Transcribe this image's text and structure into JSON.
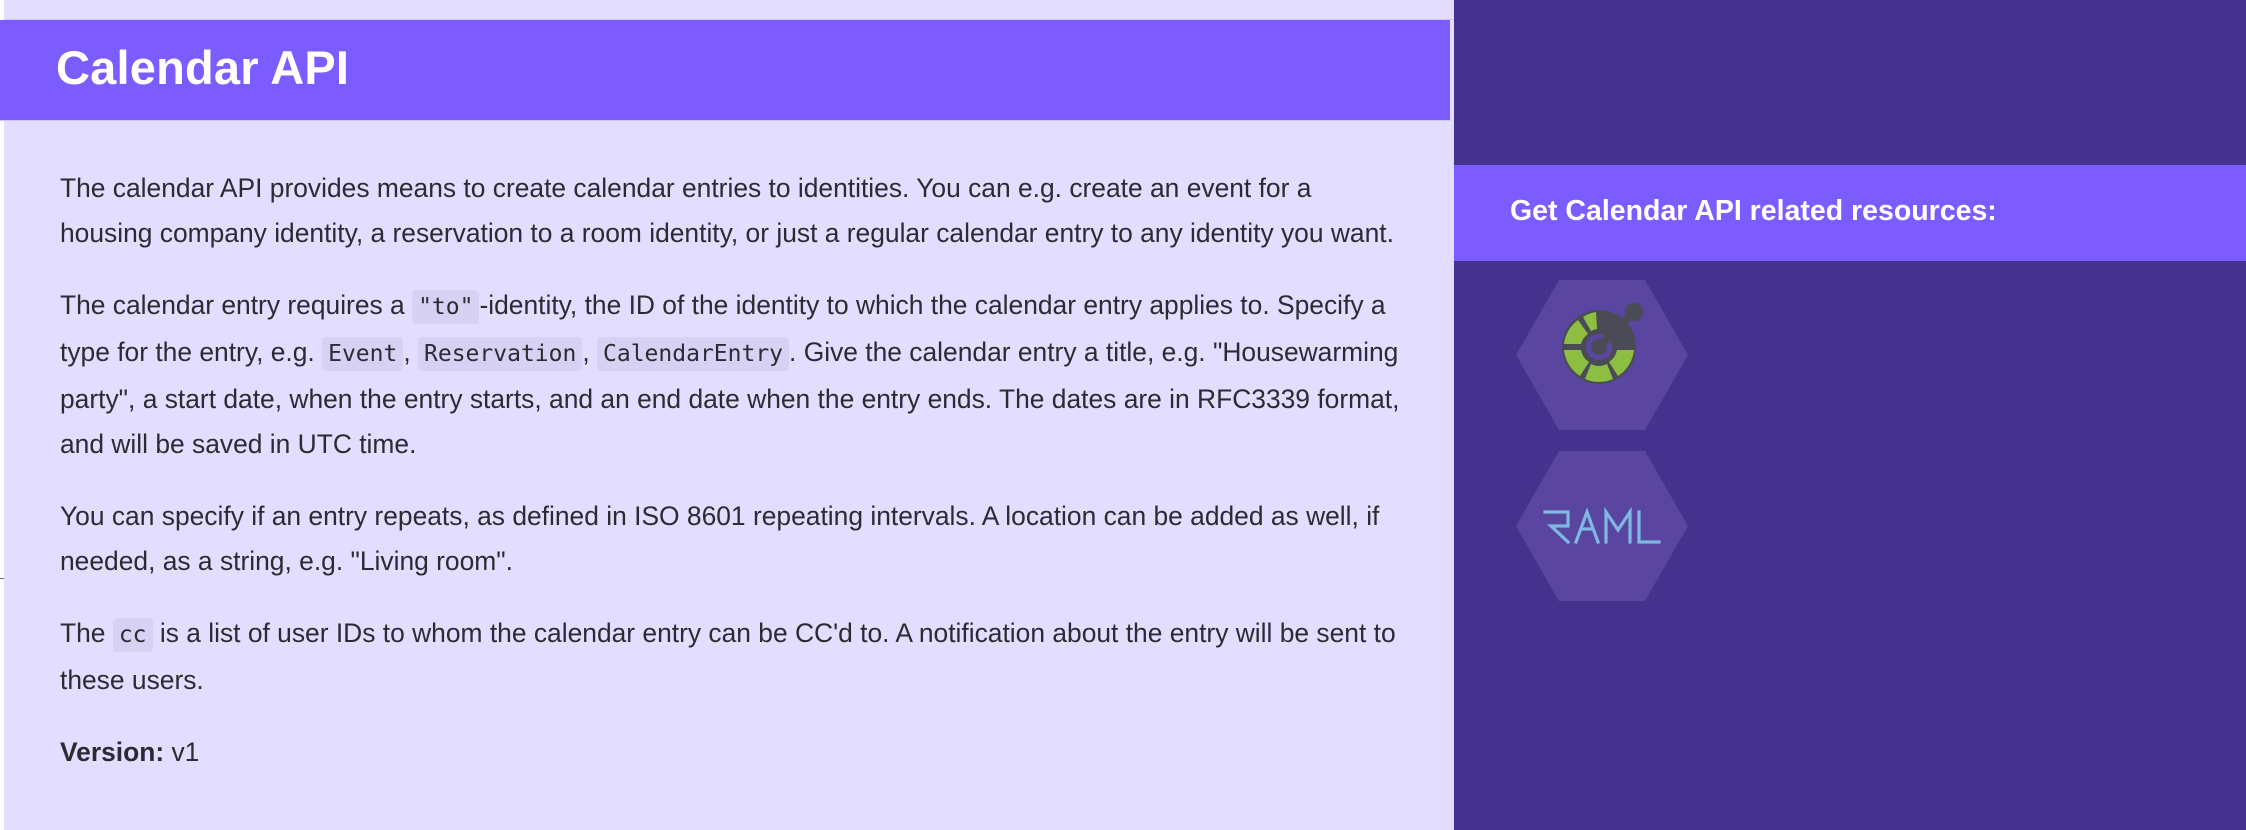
{
  "page": {
    "title": "Calendar API"
  },
  "main": {
    "p1": "The calendar API provides means to create calendar entries to identities. You can e.g. create an event for a housing company identity, a reservation to a room identity, or just a regular calendar entry to any identity you want.",
    "p2": {
      "t1": "The calendar entry requires a ",
      "code_to": "\"to\"",
      "t2": "-identity, the ID of the identity to which the calendar entry applies to. Specify a type for the entry, e.g. ",
      "code_event": "Event",
      "sep1": ", ",
      "code_reservation": "Reservation",
      "sep2": ", ",
      "code_calendarentry": "CalendarEntry",
      "t3": ". Give the calendar entry a title, e.g. \"Housewarming party\", a start date, when the entry starts, and an end date when the entry ends. The dates are in RFC3339 format, and will be saved in UTC time."
    },
    "p3": "You can specify if an entry repeats, as defined in ISO 8601 repeating intervals. A location can be added as well, if needed, as a string, e.g. \"Living room\".",
    "p4": {
      "t1": "The ",
      "code_cc": "cc",
      "t2": " is a list of user IDs to whom the calendar entry can be CC'd to. A notification about the entry will be sent to these users."
    },
    "version": {
      "label": "Version:",
      "value": " v1"
    }
  },
  "sidebar": {
    "title": "Get Calendar API related resources:",
    "resources": [
      {
        "icon": "swagger-icon",
        "label": ""
      },
      {
        "icon": "raml-icon",
        "label": "RAML"
      }
    ]
  },
  "colors": {
    "main_bg": "#e3deff",
    "accent": "#7c5cff",
    "sidebar_bg": "#45318e",
    "hex_bg": "#5a46a0",
    "swagger_green": "#8cbf41",
    "swagger_dark": "#4b4b55",
    "raml_blue": "#7fb8e0",
    "text": "#2b2b33"
  }
}
